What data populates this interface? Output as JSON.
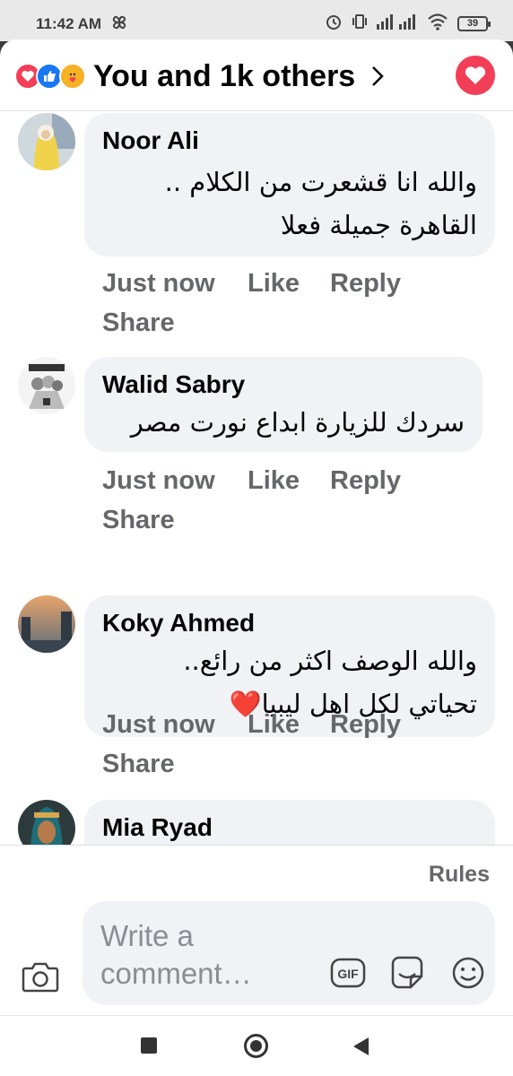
{
  "status_bar": {
    "time": "11:42 AM",
    "battery": "39"
  },
  "header": {
    "title": "You and 1k others",
    "reactions": [
      "love",
      "like",
      "care"
    ]
  },
  "comments": [
    {
      "author": "Noor Ali",
      "lines": [
        "والله انا قشعرت من الكلام ..",
        "القاهرة جميلة فعلا"
      ],
      "time": "Just now",
      "like": "Like",
      "reply": "Reply",
      "share": "Share"
    },
    {
      "author": "Walid Sabry",
      "lines": [
        "سردك للزيارة ابداع نورت مصر"
      ],
      "time": "Just now",
      "like": "Like",
      "reply": "Reply",
      "share": "Share"
    },
    {
      "author": "Koky Ahmed",
      "lines": [
        "والله الوصف اكثر من رائع..",
        "تحياتي لكل اهل ليبيا❤️"
      ],
      "time": "Just now",
      "like": "Like",
      "reply": "Reply",
      "share": "Share"
    },
    {
      "author": "Mia Ryad"
    }
  ],
  "composer": {
    "rules": "Rules",
    "placeholder": "Write a comment…",
    "gif_label": "GIF"
  },
  "colors": {
    "accent_love": "#f33e58",
    "accent_like": "#1877f2",
    "bubble_bg": "#f0f2f5",
    "secondary_text": "#65676b"
  },
  "icons": [
    "pinwheel-icon",
    "alarm-icon",
    "vibrate-icon",
    "signal-icon",
    "wifi-icon",
    "battery-icon",
    "chevron-right-icon",
    "heart-icon",
    "camera-icon",
    "gif-icon",
    "sticker-icon",
    "emoji-icon",
    "recent-apps-icon",
    "home-icon",
    "back-icon"
  ]
}
